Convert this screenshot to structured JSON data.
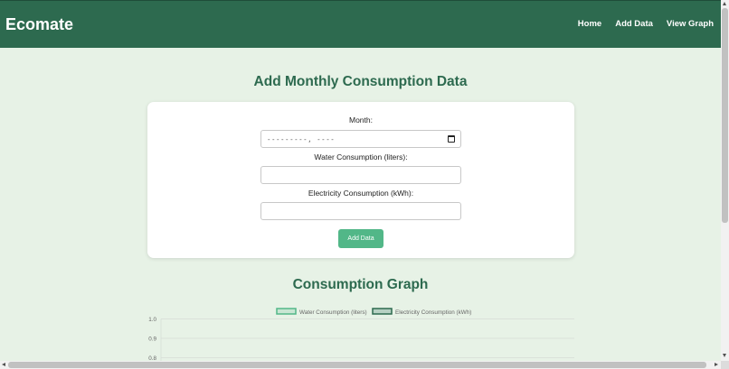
{
  "navbar": {
    "brand": "Ecomate",
    "links": [
      "Home",
      "Add Data",
      "View Graph"
    ]
  },
  "form": {
    "heading": "Add Monthly Consumption Data",
    "month_label": "Month:",
    "month_value": "---------, ----",
    "water_label": "Water Consumption (liters):",
    "water_value": "",
    "electricity_label": "Electricity Consumption (kWh):",
    "electricity_value": "",
    "submit_label": "Add Data"
  },
  "graph": {
    "heading": "Consumption Graph"
  },
  "chart_data": {
    "type": "line",
    "categories": [],
    "series": [
      {
        "name": "Water Consumption (liters)",
        "values": [],
        "color": "#52b788"
      },
      {
        "name": "Electricity Consumption (kWh)",
        "values": [],
        "color": "#2d6a4f"
      }
    ],
    "y_ticks": [
      "1.0",
      "0.9",
      "0.8"
    ],
    "ylim": [
      0,
      1.0
    ],
    "legend": "top",
    "grid": true
  },
  "colors": {
    "navbar": "#2d6a4f",
    "background": "#e7f2e6",
    "accent": "#52b788",
    "heading": "#2d6a4f"
  }
}
